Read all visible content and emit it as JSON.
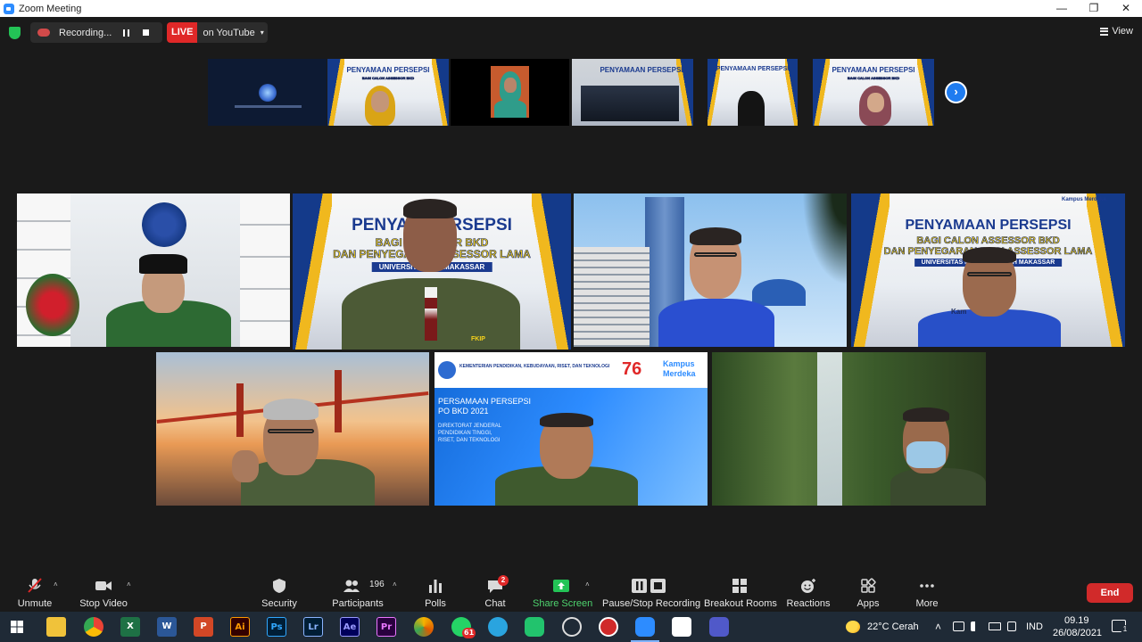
{
  "window": {
    "title": "Zoom Meeting",
    "minimize": "—",
    "restore": "❐",
    "close": "✕"
  },
  "recording": {
    "label": "Recording..."
  },
  "live": {
    "badge": "LIVE",
    "label": "on YouTube",
    "caret": "▾"
  },
  "view": {
    "label": "View"
  },
  "banner": {
    "title": "PENYAMAAN PERSEPSI",
    "title_partial": "PENYAM        PERSEPSI",
    "sub1": "BAGI CALON ASSESSOR BKD",
    "sub1_partial": "BAGI CALON      OR BKD",
    "sub2": "DAN PENYEGARAN BAGI ASSESSOR LAMA",
    "sub2_partial": "DAN PENYEGARAN     ASSESSOR LAMA",
    "univ": "UNIVERSITAS MUHAMMADIYAH MAKASSAR",
    "univ_partial": "UNIVERSITAS M            H MAKASSAR",
    "kampus": "Kampus Merdeka"
  },
  "name_tag": {
    "fkip": "FKIP",
    "kam": "Kam"
  },
  "slide": {
    "ministry": "KEMENTERIAN PENDIDIKAN, KEBUDAYAAN, RISET, DAN TEKNOLOGI",
    "anniv": "76",
    "kampus": "Kampus",
    "merdeka": "Merdeka",
    "title1": "PERSAMAAN PERSEPSI",
    "title2": "PO BKD 2021",
    "dir1": "DIREKTORAT JENDERAL",
    "dir2": "PENDIDIKAN TINGGI,",
    "dir3": "RISET, DAN TEKNOLOGI"
  },
  "next_icon": "›",
  "toolbar": {
    "unmute": "Unmute",
    "stop_video": "Stop Video",
    "security": "Security",
    "participants": "Participants",
    "participants_count": "196",
    "polls": "Polls",
    "chat": "Chat",
    "chat_badge": "2",
    "share": "Share Screen",
    "pause_stop": "Pause/Stop Recording",
    "breakout": "Breakout Rooms",
    "reactions": "Reactions",
    "apps": "Apps",
    "more": "More",
    "end": "End",
    "caret": "˄"
  },
  "taskbar": {
    "excel": "X",
    "word": "W",
    "ppt": "P",
    "ai": "Ai",
    "ps": "Ps",
    "lr": "Lr",
    "ae": "Ae",
    "pr": "Pr",
    "whatsapp_badge": "61",
    "weather": "22°C  Cerah",
    "lang": "IND",
    "time": "09.19",
    "date": "26/08/2021",
    "notif": "1"
  },
  "colors": {
    "accent": "#2d8cff",
    "live": "#e02828",
    "share": "#23c356",
    "speaking": "#d8ec70",
    "end": "#d12a2a"
  }
}
